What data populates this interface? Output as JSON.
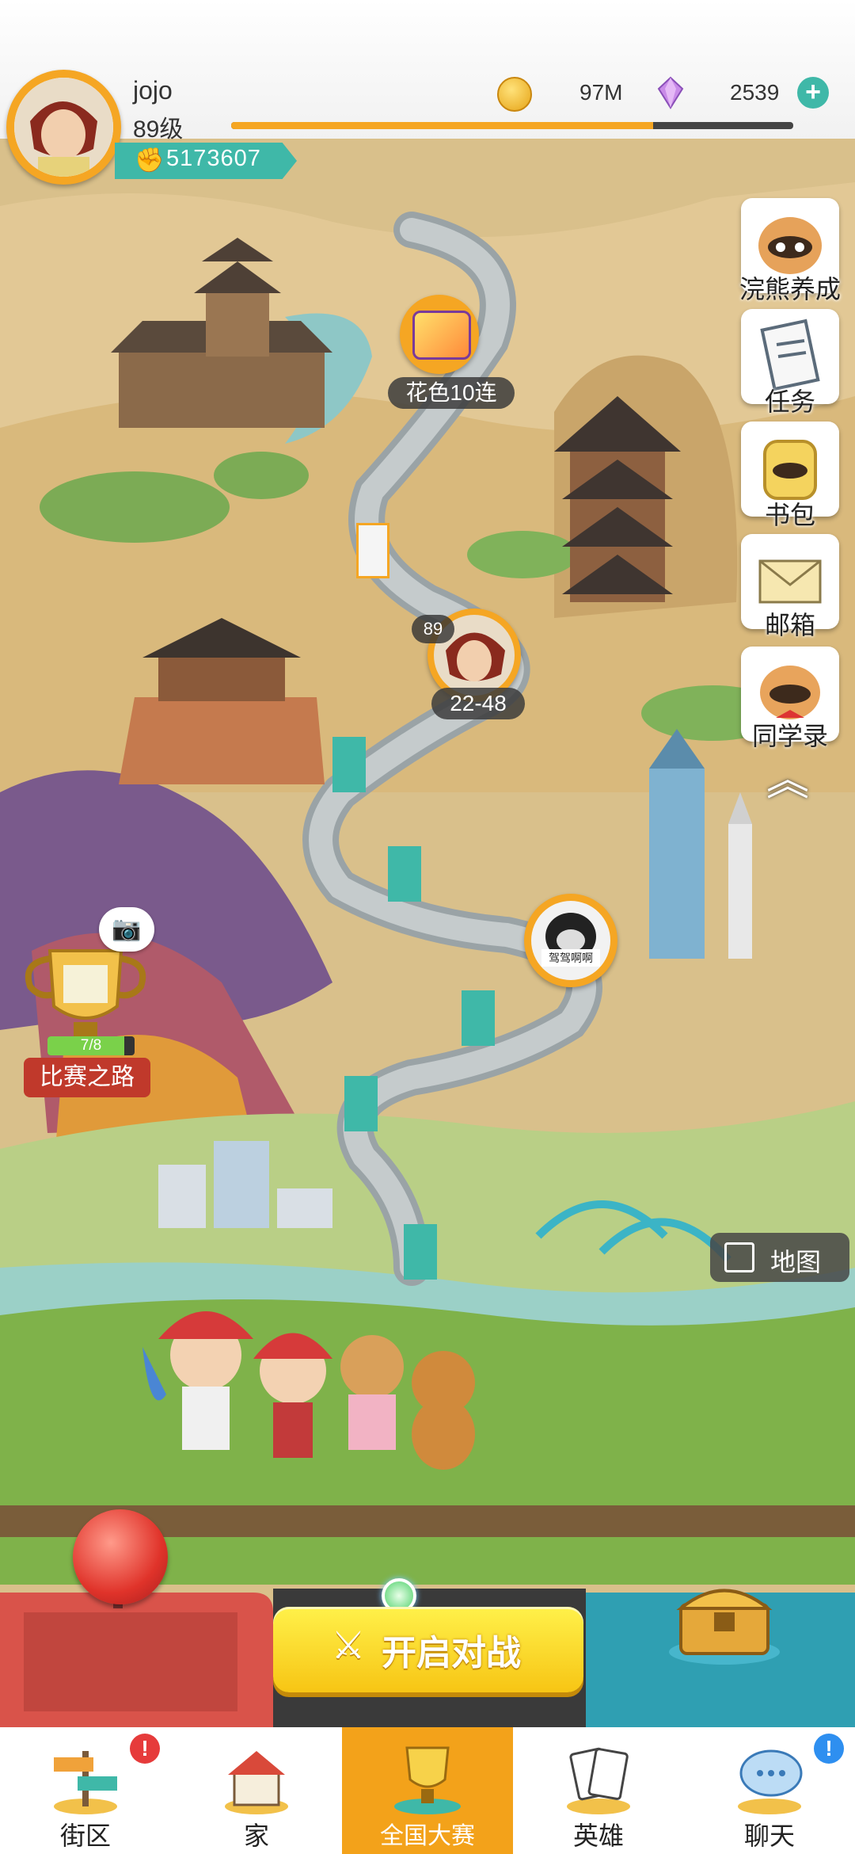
{
  "player": {
    "name": "jojo",
    "level": "89级",
    "power": "5173607",
    "xp_fraction": 0.75
  },
  "currency": {
    "coins": "97M",
    "gems": "2539"
  },
  "side_menu": [
    {
      "label": "浣熊养成"
    },
    {
      "label": "任务"
    },
    {
      "label": "书包"
    },
    {
      "label": "邮箱"
    },
    {
      "label": "同学录"
    }
  ],
  "map": {
    "reward_label": "花色10连",
    "player_level_badge": "89",
    "player_stage": "22-48",
    "opponent_tag": "驾驾啊啊",
    "trophy_progress": "7/8",
    "trophy_label": "比赛之路",
    "map_button": "地图"
  },
  "battle": {
    "button_label": "开启对战"
  },
  "tabs": [
    {
      "label": "街区",
      "badge": "!"
    },
    {
      "label": "家",
      "badge": ""
    },
    {
      "label": "全国大赛",
      "badge": ""
    },
    {
      "label": "英雄",
      "badge": ""
    },
    {
      "label": "聊天",
      "badge": "!"
    }
  ],
  "colors": {
    "accent_orange": "#f5a623",
    "accent_teal": "#3fb8a8",
    "battle_yellow": "#f7c514",
    "active_tab": "#f3a21a"
  }
}
